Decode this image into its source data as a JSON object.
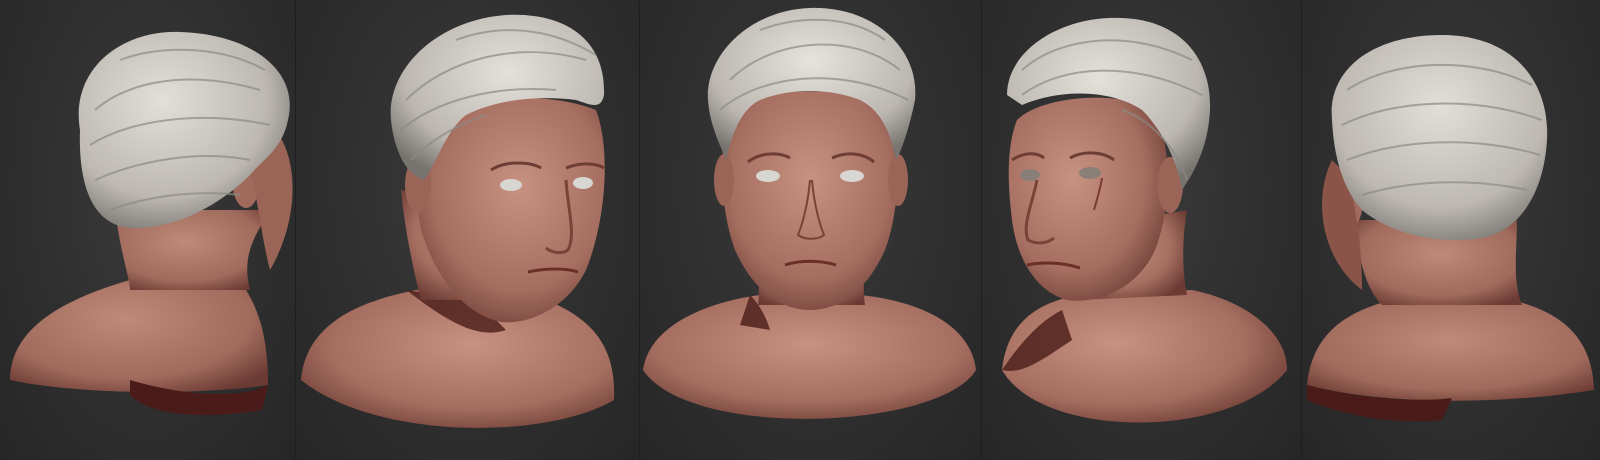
{
  "figure": {
    "views": [
      {
        "label": "",
        "angle": "back-left"
      },
      {
        "label": "",
        "angle": "three-quarter-left"
      },
      {
        "label": "",
        "angle": "front"
      },
      {
        "label": "",
        "angle": "three-quarter-right"
      },
      {
        "label": "",
        "angle": "back-right"
      }
    ]
  },
  "colors": {
    "background": "#2d2d2d",
    "skin": "#a87466",
    "skin_shadow": "#5a2a26",
    "hair": "#c9c5c0",
    "hair_shadow": "#8d8984",
    "eye": "#d8d6d2"
  }
}
